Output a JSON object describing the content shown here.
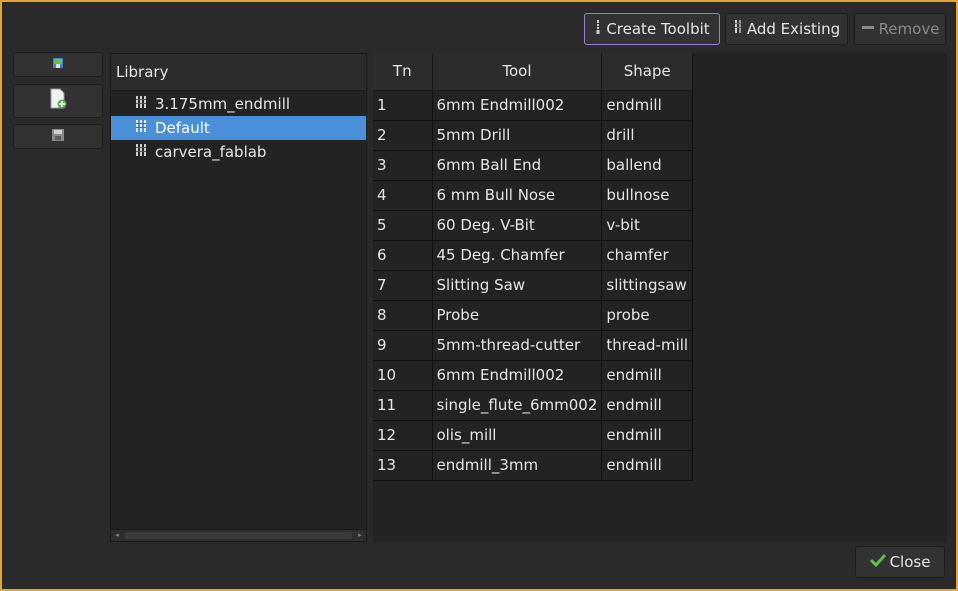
{
  "toolbar": {
    "create_toolbit": "Create Toolbit",
    "add_existing": "Add Existing",
    "remove": "Remove"
  },
  "sidebar": {
    "buttons": [
      {
        "name": "open-library-icon"
      },
      {
        "name": "new-library-icon"
      },
      {
        "name": "save-library-icon"
      }
    ]
  },
  "library": {
    "header": "Library",
    "items": [
      {
        "label": "3.175mm_endmill",
        "selected": false
      },
      {
        "label": "Default",
        "selected": true
      },
      {
        "label": "carvera_fablab",
        "selected": false
      }
    ]
  },
  "table": {
    "headers": [
      "Tn",
      "Tool",
      "Shape"
    ],
    "rows": [
      {
        "tn": "1",
        "tool": "6mm Endmill002",
        "shape": "endmill"
      },
      {
        "tn": "2",
        "tool": "5mm Drill",
        "shape": "drill"
      },
      {
        "tn": "3",
        "tool": "6mm Ball End",
        "shape": "ballend"
      },
      {
        "tn": "4",
        "tool": "6 mm Bull Nose",
        "shape": "bullnose"
      },
      {
        "tn": "5",
        "tool": "60 Deg. V-Bit",
        "shape": "v-bit"
      },
      {
        "tn": "6",
        "tool": "45 Deg. Chamfer",
        "shape": "chamfer"
      },
      {
        "tn": "7",
        "tool": "Slitting Saw",
        "shape": "slittingsaw"
      },
      {
        "tn": "8",
        "tool": "Probe",
        "shape": "probe"
      },
      {
        "tn": "9",
        "tool": "5mm-thread-cutter",
        "shape": "thread-mill"
      },
      {
        "tn": "10",
        "tool": "6mm Endmill002",
        "shape": "endmill"
      },
      {
        "tn": "11",
        "tool": "single_flute_6mm002",
        "shape": "endmill"
      },
      {
        "tn": "12",
        "tool": "olis_mill",
        "shape": "endmill"
      },
      {
        "tn": "13",
        "tool": "endmill_3mm",
        "shape": "endmill"
      }
    ]
  },
  "footer": {
    "close": "Close"
  }
}
